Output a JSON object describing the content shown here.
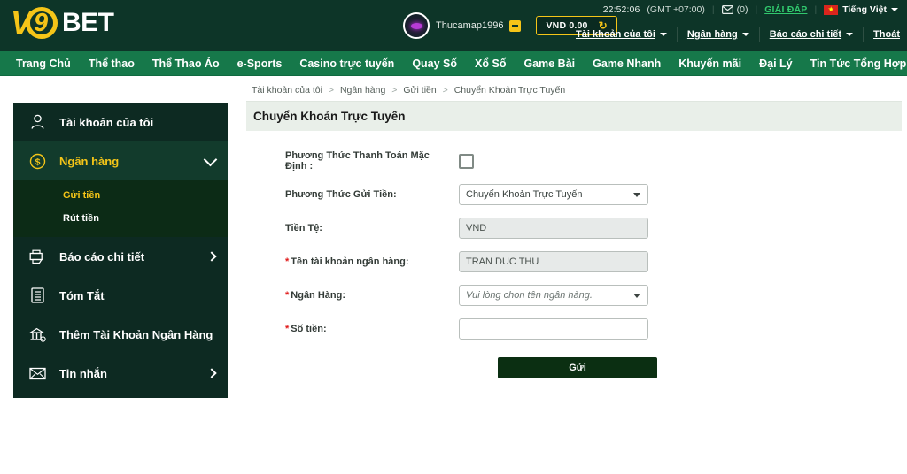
{
  "header": {
    "logo": {
      "v": "V",
      "nine": "9",
      "bet": "BET"
    },
    "utility": {
      "time": "22:52:06",
      "timezone": "(GMT +07:00)",
      "mail_icon": "envelope-icon",
      "mail_count": "(0)",
      "help_label": "GIẢI ĐÁP",
      "flag_icon": "vietnam-flag-icon",
      "language": "Tiếng Việt"
    },
    "user": {
      "avatar_icon": "user-avatar-icon",
      "username": "Thucamap1996",
      "status_badge_icon": "minus-badge-icon",
      "balance": "VND 0.00",
      "refresh_icon": "refresh-icon"
    },
    "account_menu": [
      {
        "label": "Tài khoản của tôi",
        "has_caret": true
      },
      {
        "label": "Ngân hàng",
        "has_caret": true
      },
      {
        "label": "Báo cáo chi tiết",
        "has_caret": true
      },
      {
        "label": "Thoát",
        "has_caret": false
      }
    ]
  },
  "mainnav": {
    "items": [
      "Trang Chủ",
      "Thể thao",
      "Thể Thao Ảo",
      "e-Sports",
      "Casino trực tuyến",
      "Quay Số",
      "Xổ Số",
      "Game Bài",
      "Game Nhanh",
      "Khuyến mãi",
      "Đại Lý",
      "Tin Tức Tổng Hợp"
    ]
  },
  "sidebar": {
    "items": [
      {
        "label": "Tài khoản của tôi",
        "icon": "user-icon",
        "active": false,
        "chevron": ""
      },
      {
        "label": "Ngân hàng",
        "icon": "dollar-coin-icon",
        "active": true,
        "chevron": "down"
      },
      {
        "label": "Báo cáo chi tiết",
        "icon": "report-printer-icon",
        "active": false,
        "chevron": "right"
      },
      {
        "label": "Tóm Tắt",
        "icon": "summary-list-icon",
        "active": false,
        "chevron": ""
      },
      {
        "label": "Thêm Tài Khoản Ngân Hàng",
        "icon": "bank-building-icon",
        "active": false,
        "chevron": ""
      },
      {
        "label": "Tin nhắn",
        "icon": "message-envelope-icon",
        "active": false,
        "chevron": "right"
      }
    ],
    "submenu": [
      {
        "label": "Gửi tiền",
        "active": true
      },
      {
        "label": "Rút tiền",
        "active": false
      }
    ]
  },
  "content": {
    "breadcrumb": [
      "Tài khoản của tôi",
      "Ngân hàng",
      "Gửi tiền",
      "Chuyển Khoản Trực Tuyến"
    ],
    "breadcrumb_separator": ">",
    "page_title": "Chuyển Khoản Trực Tuyến",
    "form": {
      "default_payment": {
        "label": "Phương Thức Thanh Toán Mặc Định :",
        "checked": false,
        "required": false
      },
      "deposit_method": {
        "label": "Phương Thức Gửi Tiền:",
        "value": "Chuyển Khoản Trực Tuyến",
        "required": false
      },
      "currency": {
        "label": "Tiền Tệ:",
        "value": "VND",
        "required": false,
        "readonly": true
      },
      "bank_account_name": {
        "label": "Tên tài khoản ngân hàng:",
        "value": "TRAN DUC THU",
        "required": true,
        "readonly": true
      },
      "bank": {
        "label": "Ngân Hàng:",
        "value": "Vui lòng chọn tên ngân hàng.",
        "required": true,
        "is_placeholder": true
      },
      "amount": {
        "label": "Số tiền:",
        "value": "",
        "placeholder": "",
        "required": true
      },
      "submit_label": "Gửi"
    }
  },
  "colors": {
    "header_bg": "#0d3528",
    "nav_bg": "#16784a",
    "sidebar_bg": "#0d2a22",
    "accent_gold": "#f5c518",
    "help_green": "#31c96e",
    "submit_bg": "#0b2f12",
    "title_band": "#e9efe9"
  }
}
